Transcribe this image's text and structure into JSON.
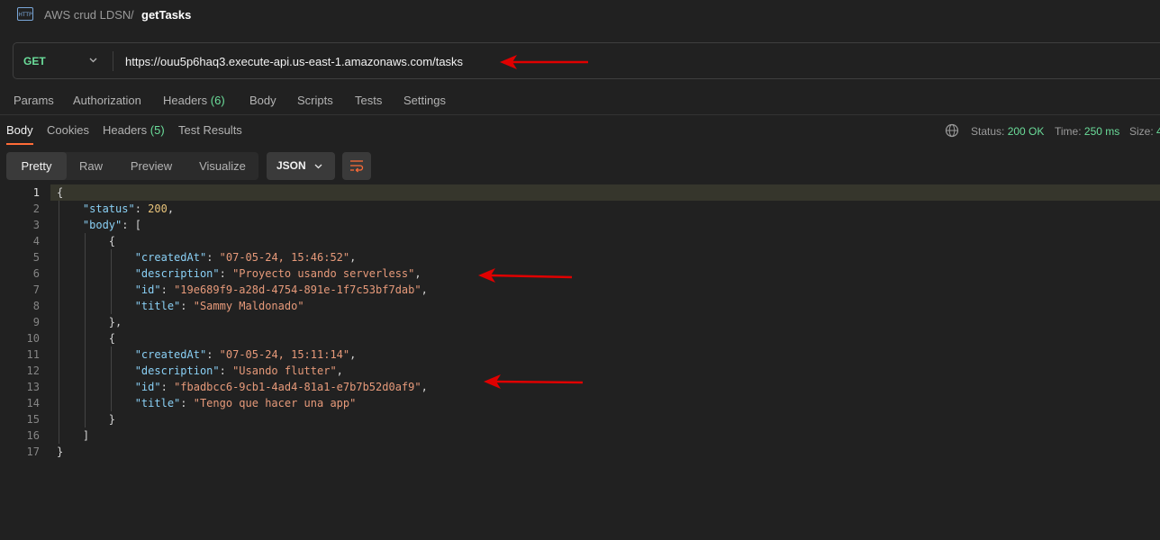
{
  "breadcrumb": {
    "icon": "http-request-icon",
    "collection": "AWS crud LDSN",
    "separator": "/",
    "request": "getTasks"
  },
  "request": {
    "method": "GET",
    "url": "https://ouu5p6haq3.execute-api.us-east-1.amazonaws.com/tasks"
  },
  "request_tabs": {
    "params": "Params",
    "authorization": "Authorization",
    "headers": "Headers",
    "headers_count": "(6)",
    "body": "Body",
    "scripts": "Scripts",
    "tests": "Tests",
    "settings": "Settings"
  },
  "response_tabs": {
    "body": "Body",
    "cookies": "Cookies",
    "headers": "Headers",
    "headers_count": "(5)",
    "test_results": "Test Results"
  },
  "response_meta": {
    "status_label": "Status:",
    "status_value": "200 OK",
    "time_label": "Time:",
    "time_value": "250 ms",
    "size_label": "Size:",
    "size_value": "4"
  },
  "format": {
    "pretty": "Pretty",
    "raw": "Raw",
    "preview": "Preview",
    "visualize": "Visualize",
    "language": "JSON"
  },
  "line_numbers": [
    "1",
    "2",
    "3",
    "4",
    "5",
    "6",
    "7",
    "8",
    "9",
    "10",
    "11",
    "12",
    "13",
    "14",
    "15",
    "16",
    "17"
  ],
  "code": {
    "open_brace": "{",
    "status_key": "\"status\"",
    "status_value": "200",
    "body_key": "\"body\"",
    "open_bracket": "[",
    "items": [
      {
        "createdAt_key": "\"createdAt\"",
        "createdAt": "\"07-05-24, 15:46:52\"",
        "description_key": "\"description\"",
        "description": "\"Proyecto usando serverless\"",
        "id_key": "\"id\"",
        "id": "\"19e689f9-a28d-4754-891e-1f7c53bf7dab\"",
        "title_key": "\"title\"",
        "title": "\"Sammy Maldonado\""
      },
      {
        "createdAt_key": "\"createdAt\"",
        "createdAt": "\"07-05-24, 15:11:14\"",
        "description_key": "\"description\"",
        "description": "\"Usando flutter\"",
        "id_key": "\"id\"",
        "id": "\"fbadbcc6-9cb1-4ad4-81a1-e7b7b52d0af9\"",
        "title_key": "\"title\"",
        "title": "\"Tengo que hacer una app\""
      }
    ],
    "close_bracket": "]",
    "close_brace": "}"
  },
  "colors": {
    "accent": "#ff6c37",
    "success": "#6bdd9a",
    "annotation_arrow": "#e00000"
  }
}
